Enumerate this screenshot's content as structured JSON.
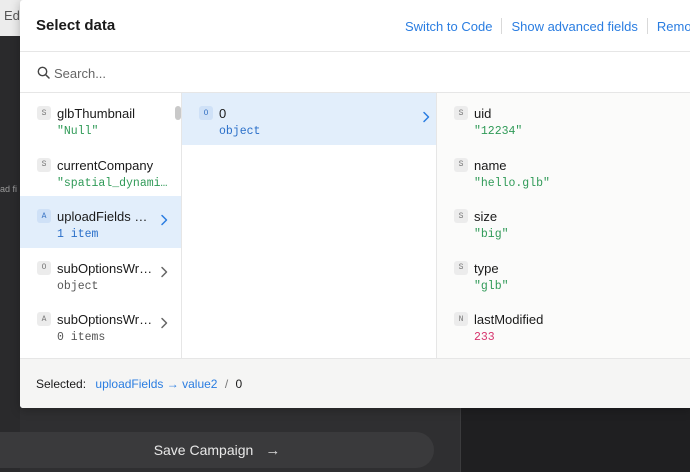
{
  "background": {
    "top_text": "Edi",
    "left_text": "ad fi",
    "save_label": "Save Campaign",
    "save_arrow": "→"
  },
  "modal": {
    "title": "Select data",
    "actions": [
      "Switch to Code",
      "Show advanced fields",
      "Remo"
    ],
    "search_placeholder": "Search...",
    "columns": [
      {
        "items": [
          {
            "badge": "S",
            "name": "glbThumbnail",
            "value": "\"Null\"",
            "kind": "str"
          },
          {
            "badge": "S",
            "name": "currentCompany",
            "value": "\"spatial_dynami…",
            "kind": "str"
          },
          {
            "badge": "A",
            "name": "uploadFields …",
            "value": "1 item",
            "kind": "meta",
            "selected": true,
            "chevron": true
          },
          {
            "badge": "O",
            "name": "subOptionsWr…",
            "value": "object",
            "kind": "meta",
            "chevron": true
          },
          {
            "badge": "A",
            "name": "subOptionsWr…",
            "value": "0 items",
            "kind": "meta",
            "chevron": true
          }
        ]
      },
      {
        "items": [
          {
            "badge": "O",
            "name": "0",
            "value": "object",
            "kind": "meta",
            "selected": true,
            "chevron": true
          }
        ]
      },
      {
        "items": [
          {
            "badge": "S",
            "name": "uid",
            "value": "\"12234\"",
            "kind": "str"
          },
          {
            "badge": "S",
            "name": "name",
            "value": "\"hello.glb\"",
            "kind": "str"
          },
          {
            "badge": "S",
            "name": "size",
            "value": "\"big\"",
            "kind": "str"
          },
          {
            "badge": "S",
            "name": "type",
            "value": "\"glb\"",
            "kind": "str"
          },
          {
            "badge": "N",
            "name": "lastModified",
            "value": "233",
            "kind": "num"
          }
        ]
      }
    ],
    "footer": {
      "label": "Selected:",
      "path": "uploadFields → value2",
      "separator": "/",
      "index": "0"
    }
  },
  "colors": {
    "accent": "#2a7de1",
    "selected_bg": "#e2eefb",
    "string_value": "#2f9a57",
    "number_value": "#d6336c"
  }
}
